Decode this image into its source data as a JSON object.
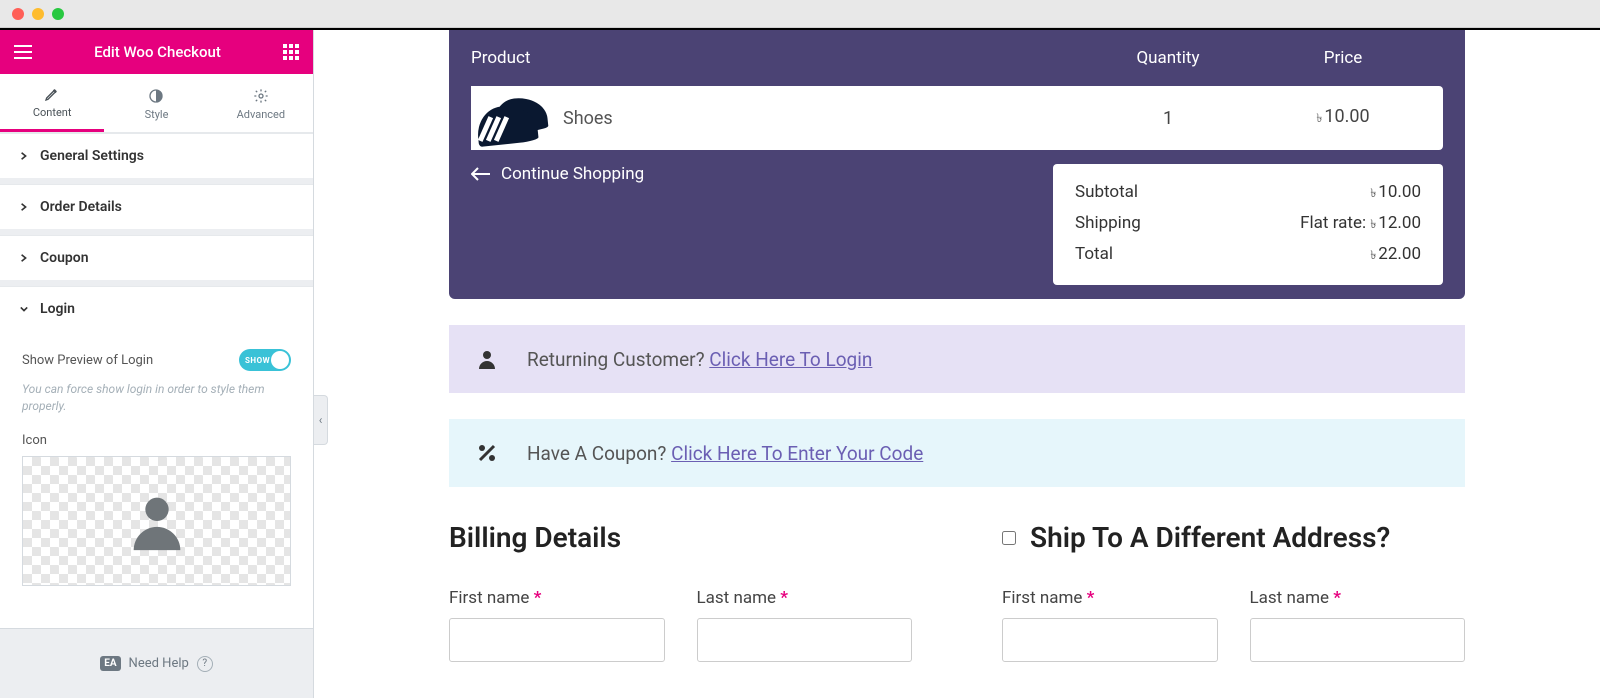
{
  "panel": {
    "title": "Edit Woo Checkout",
    "tabs": {
      "content": "Content",
      "style": "Style",
      "advanced": "Advanced"
    },
    "sections": {
      "general": "General Settings",
      "order": "Order Details",
      "coupon": "Coupon",
      "login": "Login"
    },
    "login": {
      "toggle_label": "Show Preview of Login",
      "toggle_state": "SHOW",
      "hint": "You can force show login in order to style them properly.",
      "icon_label": "Icon"
    },
    "footer": {
      "need_help": "Need Help",
      "badge": "EA"
    }
  },
  "checkout": {
    "headers": {
      "product": "Product",
      "quantity": "Quantity",
      "price": "Price"
    },
    "item": {
      "name": "Shoes",
      "qty": "1",
      "price": "10.00"
    },
    "continue": "Continue Shopping",
    "currency_symbol": "৳",
    "totals": {
      "subtotal_label": "Subtotal",
      "subtotal": "10.00",
      "shipping_label": "Shipping",
      "shipping_prefix": "Flat rate:",
      "shipping": "12.00",
      "total_label": "Total",
      "total": "22.00"
    },
    "login_notice": {
      "text": "Returning Customer?",
      "link": "Click Here To Login"
    },
    "coupon_notice": {
      "text": "Have A Coupon?",
      "link": "Click Here To Enter Your Code"
    },
    "billing_title": "Billing Details",
    "ship_title": "Ship To A Different Address?",
    "fields": {
      "first_name": "First name",
      "last_name": "Last name",
      "required": "*"
    }
  }
}
